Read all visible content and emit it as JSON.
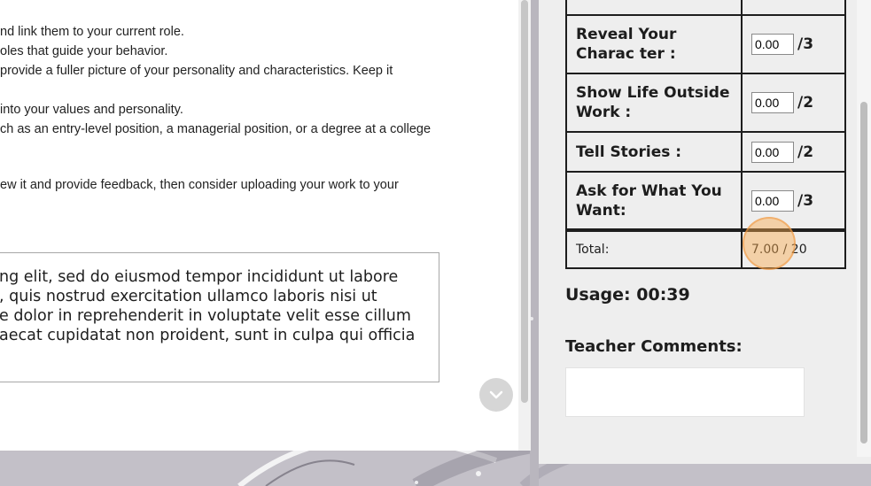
{
  "document": {
    "lines": [
      "nd link them to your current role.",
      "oles that guide your behavior.",
      " provide a fuller picture of your personality and characteristics. Keep it",
      " into your values and personality.",
      "ch as an entry-level position, a managerial position, or a degree at a college",
      "ew it and provide feedback, then consider uploading your work to your"
    ],
    "answer_lines": [
      "ng elit, sed do eiusmod tempor incididunt ut labore",
      ", quis nostrud exercitation ullamco laboris nisi ut",
      "e dolor in reprehenderit in voluptate velit esse cillum",
      "aecat cupidatat non proident, sunt in culpa qui officia"
    ]
  },
  "rubric": {
    "rows": [
      {
        "label": "Reveal Your Charac ter :",
        "value": "0.00",
        "max": "/3"
      },
      {
        "label": "Show Life Outside Work :",
        "value": "0.00",
        "max": "/2"
      },
      {
        "label": "Tell Stories :",
        "value": "0.00",
        "max": "/2"
      },
      {
        "label": "Ask for What You Want:",
        "value": "0.00",
        "max": "/3"
      }
    ],
    "total_label": "Total:",
    "total_value": "7.00 / 20"
  },
  "usage": "Usage: 00:39",
  "teacher_comments_label": "Teacher Comments:",
  "colors": {
    "click_marker": "#f8aa50",
    "panel_bg": "#eeeeee",
    "text": "#1d1d1d"
  }
}
